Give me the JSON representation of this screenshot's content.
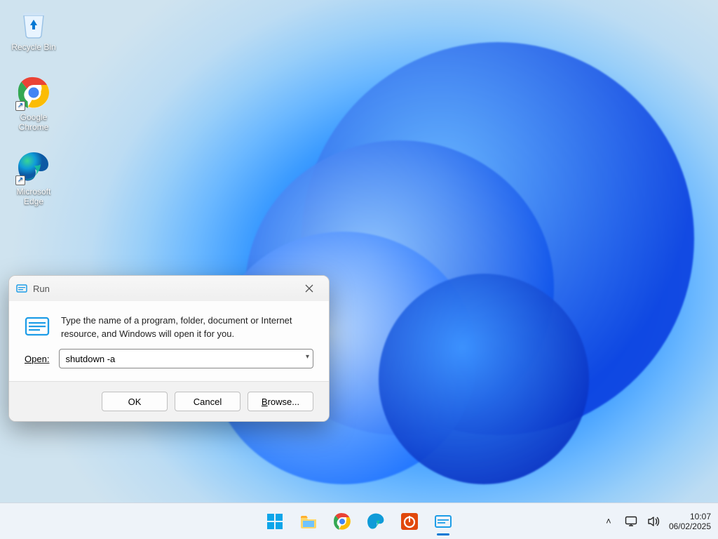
{
  "desktop_icons": [
    {
      "name": "recycle-bin",
      "label": "Recycle Bin",
      "shortcut": false
    },
    {
      "name": "google-chrome",
      "label": "Google Chrome",
      "shortcut": true
    },
    {
      "name": "microsoft-edge",
      "label": "Microsoft Edge",
      "shortcut": true
    }
  ],
  "run_dialog": {
    "title": "Run",
    "instructions": "Type the name of a program, folder, document or Internet resource, and Windows will open it for you.",
    "open_label": "Open:",
    "input_value": "shutdown -a",
    "buttons": {
      "ok": "OK",
      "cancel": "Cancel",
      "browse": "Browse..."
    }
  },
  "taskbar": {
    "items": [
      {
        "name": "start",
        "icon": "windows-icon",
        "active": false
      },
      {
        "name": "file-explorer",
        "icon": "folder-icon",
        "active": false
      },
      {
        "name": "google-chrome",
        "icon": "chrome-icon",
        "active": false
      },
      {
        "name": "microsoft-edge",
        "icon": "edge-icon",
        "active": false
      },
      {
        "name": "app-orange",
        "icon": "power-icon",
        "active": false
      },
      {
        "name": "run",
        "icon": "run-icon",
        "active": true
      }
    ],
    "tray": {
      "chevron": "˄",
      "time": "10:07",
      "date": "06/02/2025"
    }
  }
}
